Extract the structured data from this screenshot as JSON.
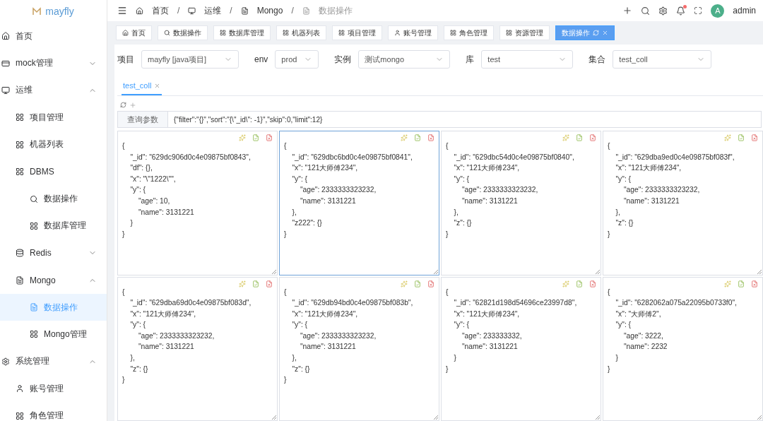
{
  "logo": {
    "text": "mayfly"
  },
  "breadcrumb_separator": "/",
  "breadcrumb": [
    {
      "label": "首页"
    },
    {
      "label": "运维"
    },
    {
      "label": "Mongo"
    },
    {
      "label": "数据操作"
    }
  ],
  "user": {
    "avatar": "A",
    "name": "admin",
    "has_notification": true
  },
  "sidebar": {
    "items": [
      {
        "label": "首页",
        "selected": false
      },
      {
        "label": "mock管理",
        "selected": false,
        "expanded": false
      },
      {
        "label": "运维",
        "selected": false,
        "expanded": true,
        "children": [
          {
            "label": "项目管理",
            "selected": false
          },
          {
            "label": "机器列表",
            "selected": false
          },
          {
            "label": "DBMS",
            "selected": false,
            "children": [
              {
                "label": "数据操作",
                "selected": false
              },
              {
                "label": "数据库管理",
                "selected": false
              }
            ]
          },
          {
            "label": "Redis",
            "selected": false,
            "expanded": false
          },
          {
            "label": "Mongo",
            "selected": false,
            "expanded": true,
            "children": [
              {
                "label": "数据操作",
                "selected": true
              },
              {
                "label": "Mongo管理",
                "selected": false
              }
            ]
          }
        ]
      },
      {
        "label": "系统管理",
        "selected": false,
        "expanded": true,
        "children": [
          {
            "label": "账号管理",
            "selected": false
          },
          {
            "label": "角色管理",
            "selected": false
          }
        ]
      }
    ]
  },
  "tags": [
    {
      "label": "首页",
      "selected": false
    },
    {
      "label": "数据操作",
      "selected": false
    },
    {
      "label": "数据库管理",
      "selected": false
    },
    {
      "label": "机器列表",
      "selected": false
    },
    {
      "label": "项目管理",
      "selected": false
    },
    {
      "label": "账号管理",
      "selected": false
    },
    {
      "label": "角色管理",
      "selected": false
    },
    {
      "label": "资源管理",
      "selected": false
    },
    {
      "label": "数据操作",
      "selected": true
    }
  ],
  "filters": [
    {
      "label": "项目",
      "value": "mayfly [java项目]"
    },
    {
      "label": "env",
      "value": "prod"
    },
    {
      "label": "实例",
      "value": "测试mongo"
    },
    {
      "label": "库",
      "value": "test"
    },
    {
      "label": "集合",
      "value": "test_coll"
    }
  ],
  "collection_tabs": [
    {
      "label": "test_coll",
      "selected": true
    }
  ],
  "query": {
    "label": "查询参数",
    "value": "{\"filter\":\"{}\",\"sort\":\"{\\\"_id\\\": -1}\",\"skip\":0,\"limit\":12}"
  },
  "documents": [
    {
      "focused": false,
      "text": "{\n    \"_id\": \"629dc906d0c4e09875bf0843\",\n    \"df\": {},\n    \"x\": \"\\\"1222\\\"\",\n    \"y\": {\n        \"age\": 10,\n        \"name\": 3131221\n    }\n}"
    },
    {
      "focused": true,
      "text": "{\n    \"_id\": \"629dbc6bd0c4e09875bf0841\",\n    \"x\": \"121大师傅234\",\n    \"y\": {\n        \"age\": 2333333323232,\n        \"name\": 3131221\n    },\n    \"z222\": {}\n}"
    },
    {
      "focused": false,
      "text": "{\n    \"_id\": \"629dbc54d0c4e09875bf0840\",\n    \"x\": \"121大师傅234\",\n    \"y\": {\n        \"age\": 2333333323232,\n        \"name\": 3131221\n    },\n    \"z\": {}\n}"
    },
    {
      "focused": false,
      "text": "{\n    \"_id\": \"629dba9ed0c4e09875bf083f\",\n    \"x\": \"121大师傅234\",\n    \"y\": {\n        \"age\": 2333333323232,\n        \"name\": 3131221\n    },\n    \"z\": {}\n}"
    },
    {
      "focused": false,
      "text": "{\n    \"_id\": \"629dba69d0c4e09875bf083d\",\n    \"x\": \"121大师傅234\",\n    \"y\": {\n        \"age\": 2333333323232,\n        \"name\": 3131221\n    },\n    \"z\": {}\n}"
    },
    {
      "focused": false,
      "text": "{\n    \"_id\": \"629db94bd0c4e09875bf083b\",\n    \"x\": \"121大师傅234\",\n    \"y\": {\n        \"age\": 2333333323232,\n        \"name\": 3131221\n    },\n    \"z\": {}\n}"
    },
    {
      "focused": false,
      "text": "{\n    \"_id\": \"62821d198d54696ce23997d8\",\n    \"x\": \"121大师傅234\",\n    \"y\": {\n        \"age\": 233333332,\n        \"name\": 3131221\n    }\n}"
    },
    {
      "focused": false,
      "text": "{\n    \"_id\": \"6282062a075a22095b0733f0\",\n    \"x\": \"大师傅2\",\n    \"y\": {\n        \"age\": 3222,\n        \"name\": 2232\n    }\n}"
    }
  ]
}
